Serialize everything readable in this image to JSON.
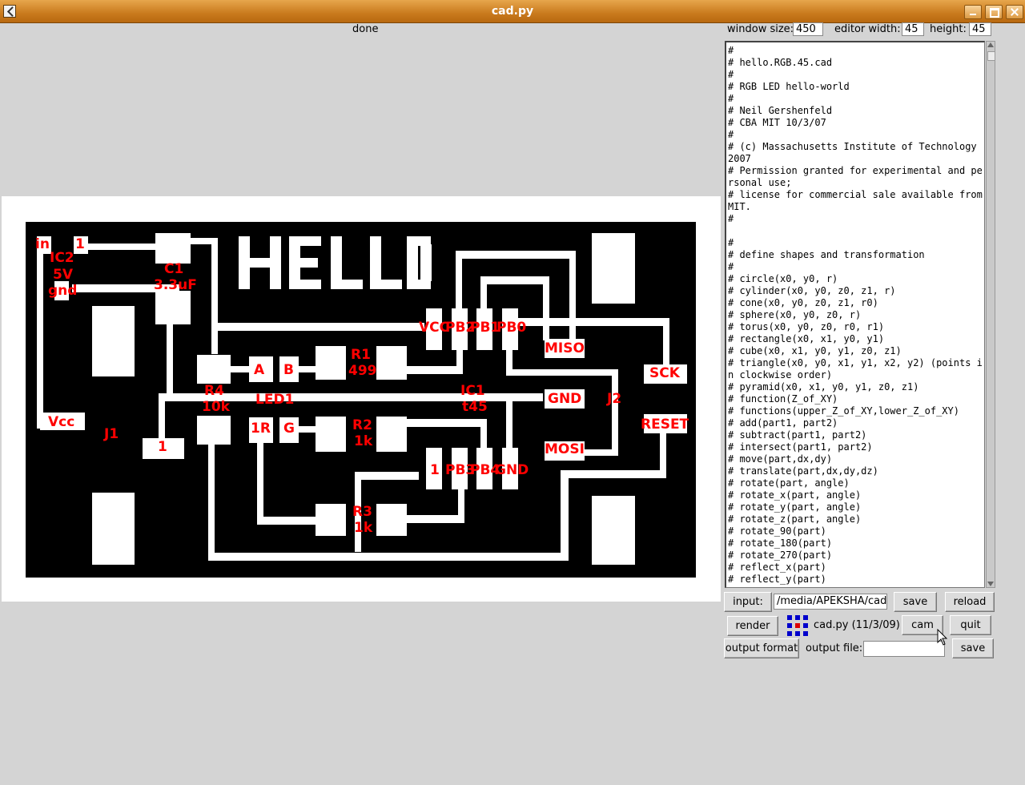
{
  "window": {
    "title": "cad.py"
  },
  "status": "done",
  "settings": {
    "window_size_label": "window size:",
    "window_size": "450",
    "editor_width_label": "editor width:",
    "editor_width": "45",
    "height_label": "height:",
    "height": "45"
  },
  "board": {
    "labels": {
      "in": "in",
      "one_top": "1",
      "ic2": "IC2",
      "v5": "5V",
      "gnd_left": "gnd",
      "c1": "C1",
      "c1_val": "3.3uF",
      "vcc": "Vcc",
      "j1": "J1",
      "one_left": "1",
      "r4": "R4",
      "r4_val": "10k",
      "a": "A",
      "b": "B",
      "led1": "LED1",
      "r1": "R1",
      "r1_val": "499",
      "r_pad": "R",
      "one_led": "1",
      "g": "G",
      "r2": "R2",
      "r2_val": "1k",
      "r3": "R3",
      "r3_val": "1k",
      "vcc_ic": "VCC",
      "pb2": "PB2",
      "pb1": "PB1",
      "pb0": "PB0",
      "miso": "MISO",
      "sck": "SCK",
      "ic1": "IC1",
      "t45": "t45",
      "gnd_ic": "GND",
      "j2": "J2",
      "reset": "RESET",
      "mosi": "MOSI",
      "one_ic": "1",
      "pb3": "PB3",
      "pb4": "PB4",
      "gnd_ic2": "GND"
    }
  },
  "editor": {
    "content": "#\n# hello.RGB.45.cad\n#\n# RGB LED hello-world\n#\n# Neil Gershenfeld\n# CBA MIT 10/3/07\n#\n# (c) Massachusetts Institute of Technology 2007\n# Permission granted for experimental and personal use;\n# license for commercial sale available from MIT.\n#\n\n#\n# define shapes and transformation\n#\n# circle(x0, y0, r)\n# cylinder(x0, y0, z0, z1, r)\n# cone(x0, y0, z0, z1, r0)\n# sphere(x0, y0, z0, r)\n# torus(x0, y0, z0, r0, r1)\n# rectangle(x0, x1, y0, y1)\n# cube(x0, x1, y0, y1, z0, z1)\n# triangle(x0, y0, x1, y1, x2, y2) (points in clockwise order)\n# pyramid(x0, x1, y0, y1, z0, z1)\n# function(Z_of_XY)\n# functions(upper_Z_of_XY,lower_Z_of_XY)\n# add(part1, part2)\n# subtract(part1, part2)\n# intersect(part1, part2)\n# move(part,dx,dy)\n# translate(part,dx,dy,dz)\n# rotate(part, angle)\n# rotate_x(part, angle)\n# rotate_y(part, angle)\n# rotate_z(part, angle)\n# rotate_90(part)\n# rotate_180(part)\n# rotate_270(part)\n# reflect_x(part)\n# reflect_y(part)"
  },
  "controls": {
    "input_label": "input:",
    "input_path": "/media/APEKSHA/cadci",
    "save_label": "save",
    "reload_label": "reload",
    "render_label": "render",
    "app_version": "cad.py (11/3/09)",
    "cam_label": "cam",
    "quit_label": "quit",
    "output_format_label": "output format",
    "output_file_label": "output file:",
    "output_file": "",
    "save_output_label": "save"
  }
}
